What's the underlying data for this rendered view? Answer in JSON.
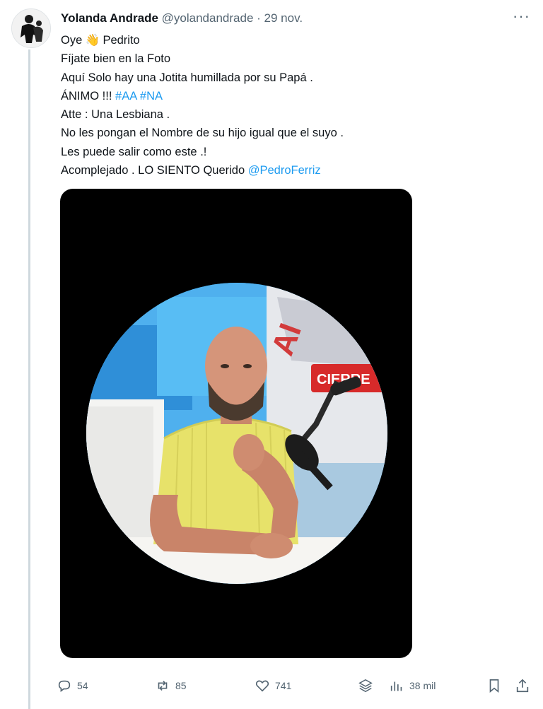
{
  "tweet": {
    "author_name": "Yolanda Andrade",
    "handle": "@yolandandrade",
    "separator": "·",
    "date": "29 nov.",
    "more_label": "···",
    "lines": [
      {
        "text": "Oye ",
        "emoji": "👋",
        "after": " Pedrito"
      },
      {
        "text": "Fíjate bien en la Foto"
      },
      {
        "text": "Aquí Solo hay una Jotita humillada por su Papá ."
      },
      {
        "text": "ÁNIMO !!! ",
        "hashtags": [
          "#AA",
          "#NA"
        ]
      },
      {
        "text": "Atte : Una Lesbiana ."
      },
      {
        "text": "No les pongan el Nombre de su hijo igual que el suyo ."
      },
      {
        "text": "Les puede salir como este .!"
      },
      {
        "text": "Acomplejado . LO SIENTO Querido ",
        "mention": "@PedroFerriz"
      }
    ],
    "image_sign_text": "CIERRE"
  },
  "actions": {
    "replies": "54",
    "retweets": "85",
    "likes": "741",
    "views": "38 mil"
  },
  "colors": {
    "link": "#1d9bf0",
    "secondary": "#536471",
    "thread_line": "#cfd9de"
  }
}
